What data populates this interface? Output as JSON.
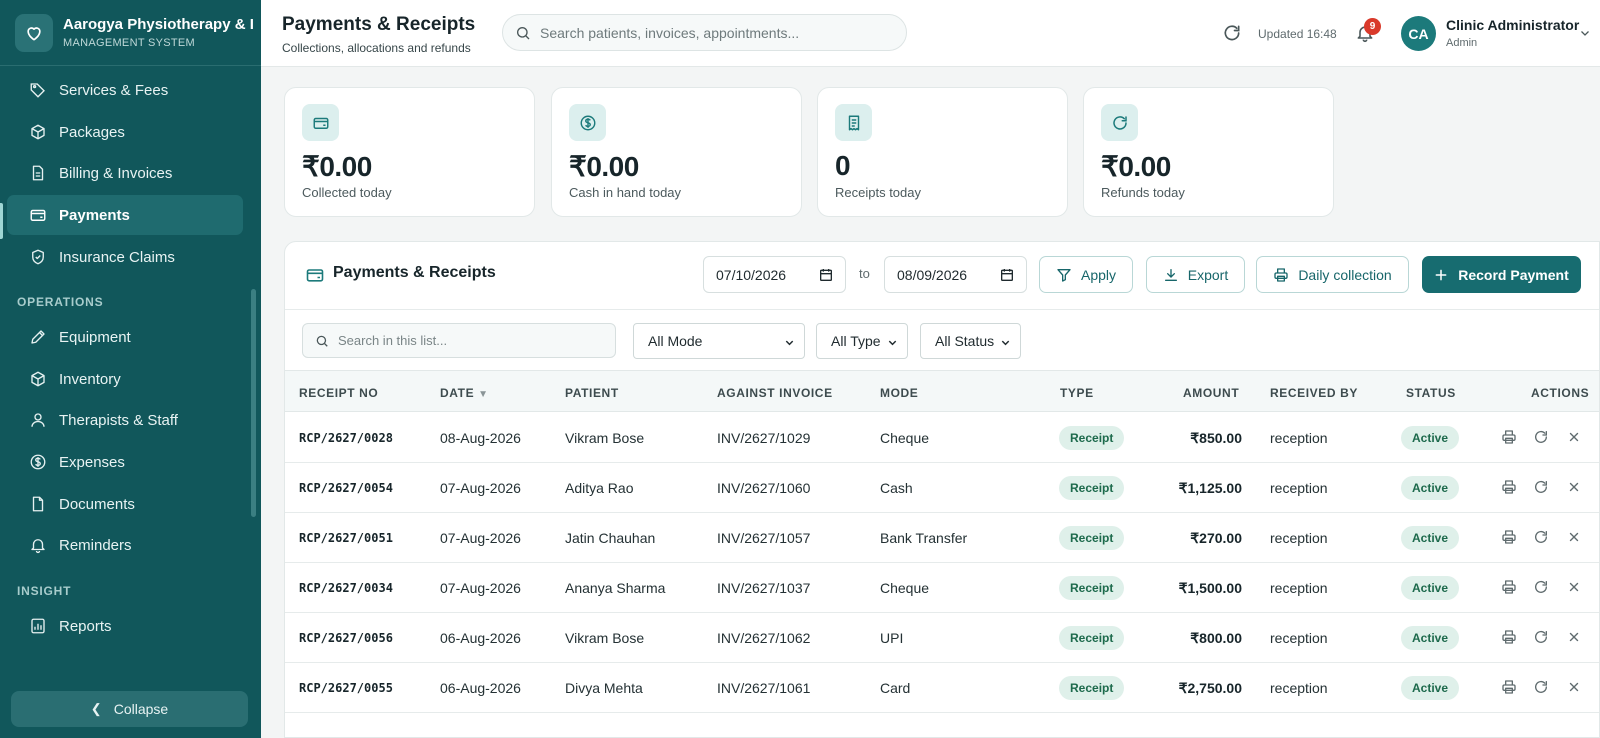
{
  "brand": {
    "name": "Aarogya Physiotherapy & I",
    "sub": "MANAGEMENT SYSTEM",
    "icon": "heart-icon"
  },
  "sidebar": {
    "items": [
      {
        "label": "Services & Fees",
        "icon": "tag-icon"
      },
      {
        "label": "Packages",
        "icon": "box-icon"
      },
      {
        "label": "Billing & Invoices",
        "icon": "file-icon"
      },
      {
        "label": "Payments",
        "icon": "wallet-icon",
        "active": true
      },
      {
        "label": "Insurance Claims",
        "icon": "shield-icon"
      }
    ],
    "section_operations": "OPERATIONS",
    "operations": [
      {
        "label": "Equipment",
        "icon": "pencil-icon"
      },
      {
        "label": "Inventory",
        "icon": "box-icon"
      },
      {
        "label": "Therapists & Staff",
        "icon": "user-icon"
      },
      {
        "label": "Expenses",
        "icon": "dollar-circle-icon"
      },
      {
        "label": "Documents",
        "icon": "document-icon"
      },
      {
        "label": "Reminders",
        "icon": "bell-icon"
      }
    ],
    "section_insight": "INSIGHT",
    "insight": [
      {
        "label": "Reports",
        "icon": "chart-icon"
      }
    ],
    "collapse_label": "Collapse"
  },
  "header": {
    "title": "Payments & Receipts",
    "subtitle": "Collections, allocations and refunds",
    "search_placeholder": "Search patients, invoices, appointments...",
    "updated": "Updated 16:48",
    "notif_count": "9",
    "user_initials": "CA",
    "user_name": "Clinic Administrator",
    "user_role": "Admin"
  },
  "stats": [
    {
      "value": "₹0.00",
      "label": "Collected today",
      "icon": "wallet-icon"
    },
    {
      "value": "₹0.00",
      "label": "Cash in hand today",
      "icon": "dollar-circle-icon"
    },
    {
      "value": "0",
      "label": "Receipts today",
      "icon": "receipt-icon"
    },
    {
      "value": "₹0.00",
      "label": "Refunds today",
      "icon": "refresh-icon"
    }
  ],
  "panel": {
    "title": "Payments & Receipts",
    "date_from": "07/10/2026",
    "date_to": "08/09/2026",
    "to_label": "to",
    "apply": "Apply",
    "export": "Export",
    "daily": "Daily collection",
    "record": "Record Payment",
    "list_search_placeholder": "Search in this list...",
    "filters": {
      "mode": "All Mode",
      "type": "All Type",
      "status": "All Status"
    }
  },
  "table": {
    "columns": [
      "RECEIPT NO",
      "DATE",
      "PATIENT",
      "AGAINST INVOICE",
      "MODE",
      "TYPE",
      "AMOUNT",
      "RECEIVED BY",
      "STATUS",
      "ACTIONS"
    ],
    "sort_indicator": "▼",
    "rows": [
      {
        "receipt": "RCP/2627/0028",
        "date": "08-Aug-2026",
        "patient": "Vikram Bose",
        "invoice": "INV/2627/1029",
        "mode": "Cheque",
        "type": "Receipt",
        "amount": "₹850.00",
        "received_by": "reception",
        "status": "Active"
      },
      {
        "receipt": "RCP/2627/0054",
        "date": "07-Aug-2026",
        "patient": "Aditya Rao",
        "invoice": "INV/2627/1060",
        "mode": "Cash",
        "type": "Receipt",
        "amount": "₹1,125.00",
        "received_by": "reception",
        "status": "Active"
      },
      {
        "receipt": "RCP/2627/0051",
        "date": "07-Aug-2026",
        "patient": "Jatin Chauhan",
        "invoice": "INV/2627/1057",
        "mode": "Bank Transfer",
        "type": "Receipt",
        "amount": "₹270.00",
        "received_by": "reception",
        "status": "Active"
      },
      {
        "receipt": "RCP/2627/0034",
        "date": "07-Aug-2026",
        "patient": "Ananya Sharma",
        "invoice": "INV/2627/1037",
        "mode": "Cheque",
        "type": "Receipt",
        "amount": "₹1,500.00",
        "received_by": "reception",
        "status": "Active"
      },
      {
        "receipt": "RCP/2627/0056",
        "date": "06-Aug-2026",
        "patient": "Vikram Bose",
        "invoice": "INV/2627/1062",
        "mode": "UPI",
        "type": "Receipt",
        "amount": "₹800.00",
        "received_by": "reception",
        "status": "Active"
      },
      {
        "receipt": "RCP/2627/0055",
        "date": "06-Aug-2026",
        "patient": "Divya Mehta",
        "invoice": "INV/2627/1061",
        "mode": "Card",
        "type": "Receipt",
        "amount": "₹2,750.00",
        "received_by": "reception",
        "status": "Active"
      }
    ]
  },
  "colors": {
    "sidebar": "#11575b",
    "accent": "#176c70",
    "pill_bg": "#dff0ea",
    "badge": "#d93a2b"
  }
}
